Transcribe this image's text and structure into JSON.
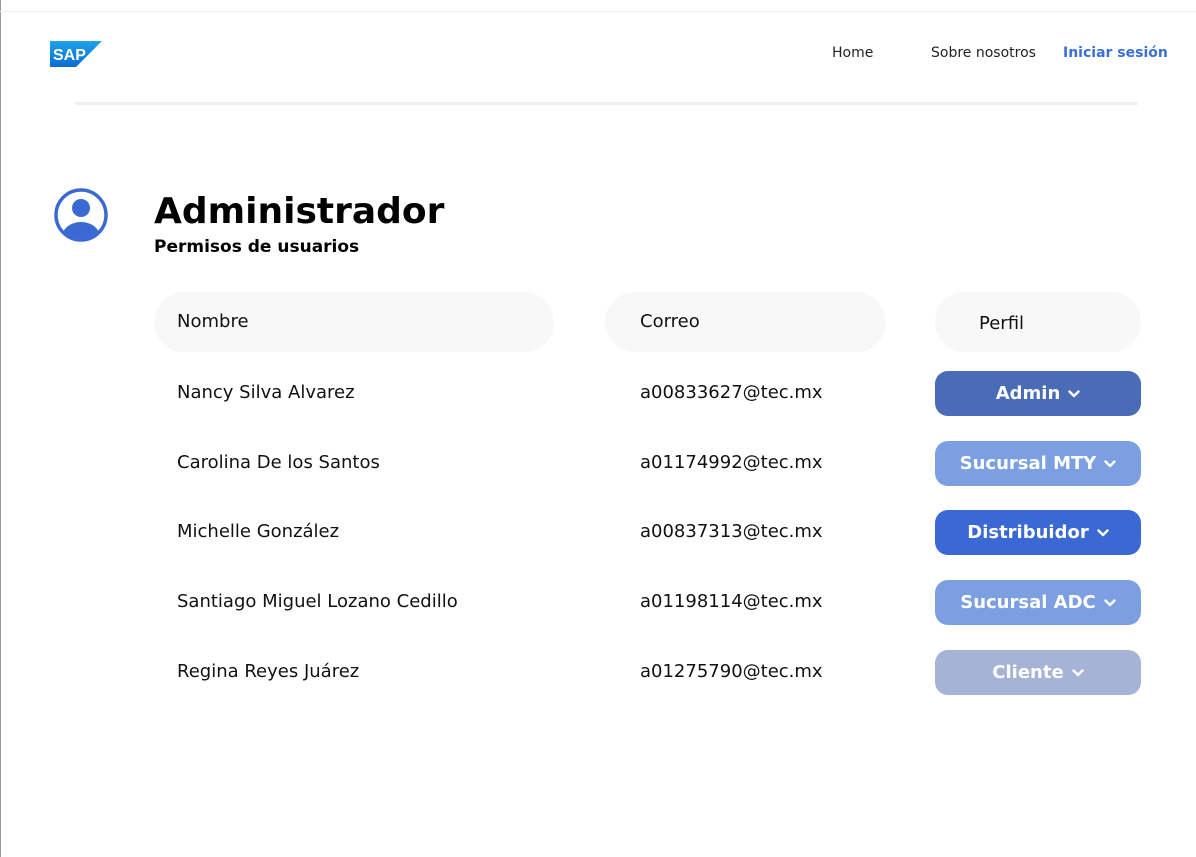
{
  "header": {
    "logo_text": "SAP",
    "nav": [
      {
        "label": "Home"
      },
      {
        "label": "Sobre nosotros"
      },
      {
        "label": "Iniciar sesión"
      }
    ]
  },
  "page": {
    "title": "Administrador",
    "subtitle": "Permisos de usuarios"
  },
  "table": {
    "columns": [
      "Nombre",
      "Correo",
      "Perfil"
    ],
    "rows": [
      {
        "name": "Nancy Silva Alvarez",
        "email": "a00833627@tec.mx",
        "role": "Admin"
      },
      {
        "name": "Carolina De los Santos",
        "email": "a01174992@tec.mx",
        "role": "Sucursal MTY"
      },
      {
        "name": "Michelle González",
        "email": "a00837313@tec.mx",
        "role": "Distribuidor"
      },
      {
        "name": "Santiago Miguel Lozano Cedillo",
        "email": "a01198114@tec.mx",
        "role": "Sucursal ADC"
      },
      {
        "name": "Regina Reyes Juárez",
        "email": "a01275790@tec.mx",
        "role": "Cliente"
      }
    ]
  },
  "colors": {
    "accent": "#3a6fd8",
    "role_admin": "#4a6bb8",
    "role_sucursal": "#7b9fe0",
    "role_distribuidor": "#3b69d4",
    "role_cliente": "#a4b3d6"
  },
  "icons": {
    "profile": "user-circle-icon",
    "dropdown": "chevron-down-icon"
  }
}
